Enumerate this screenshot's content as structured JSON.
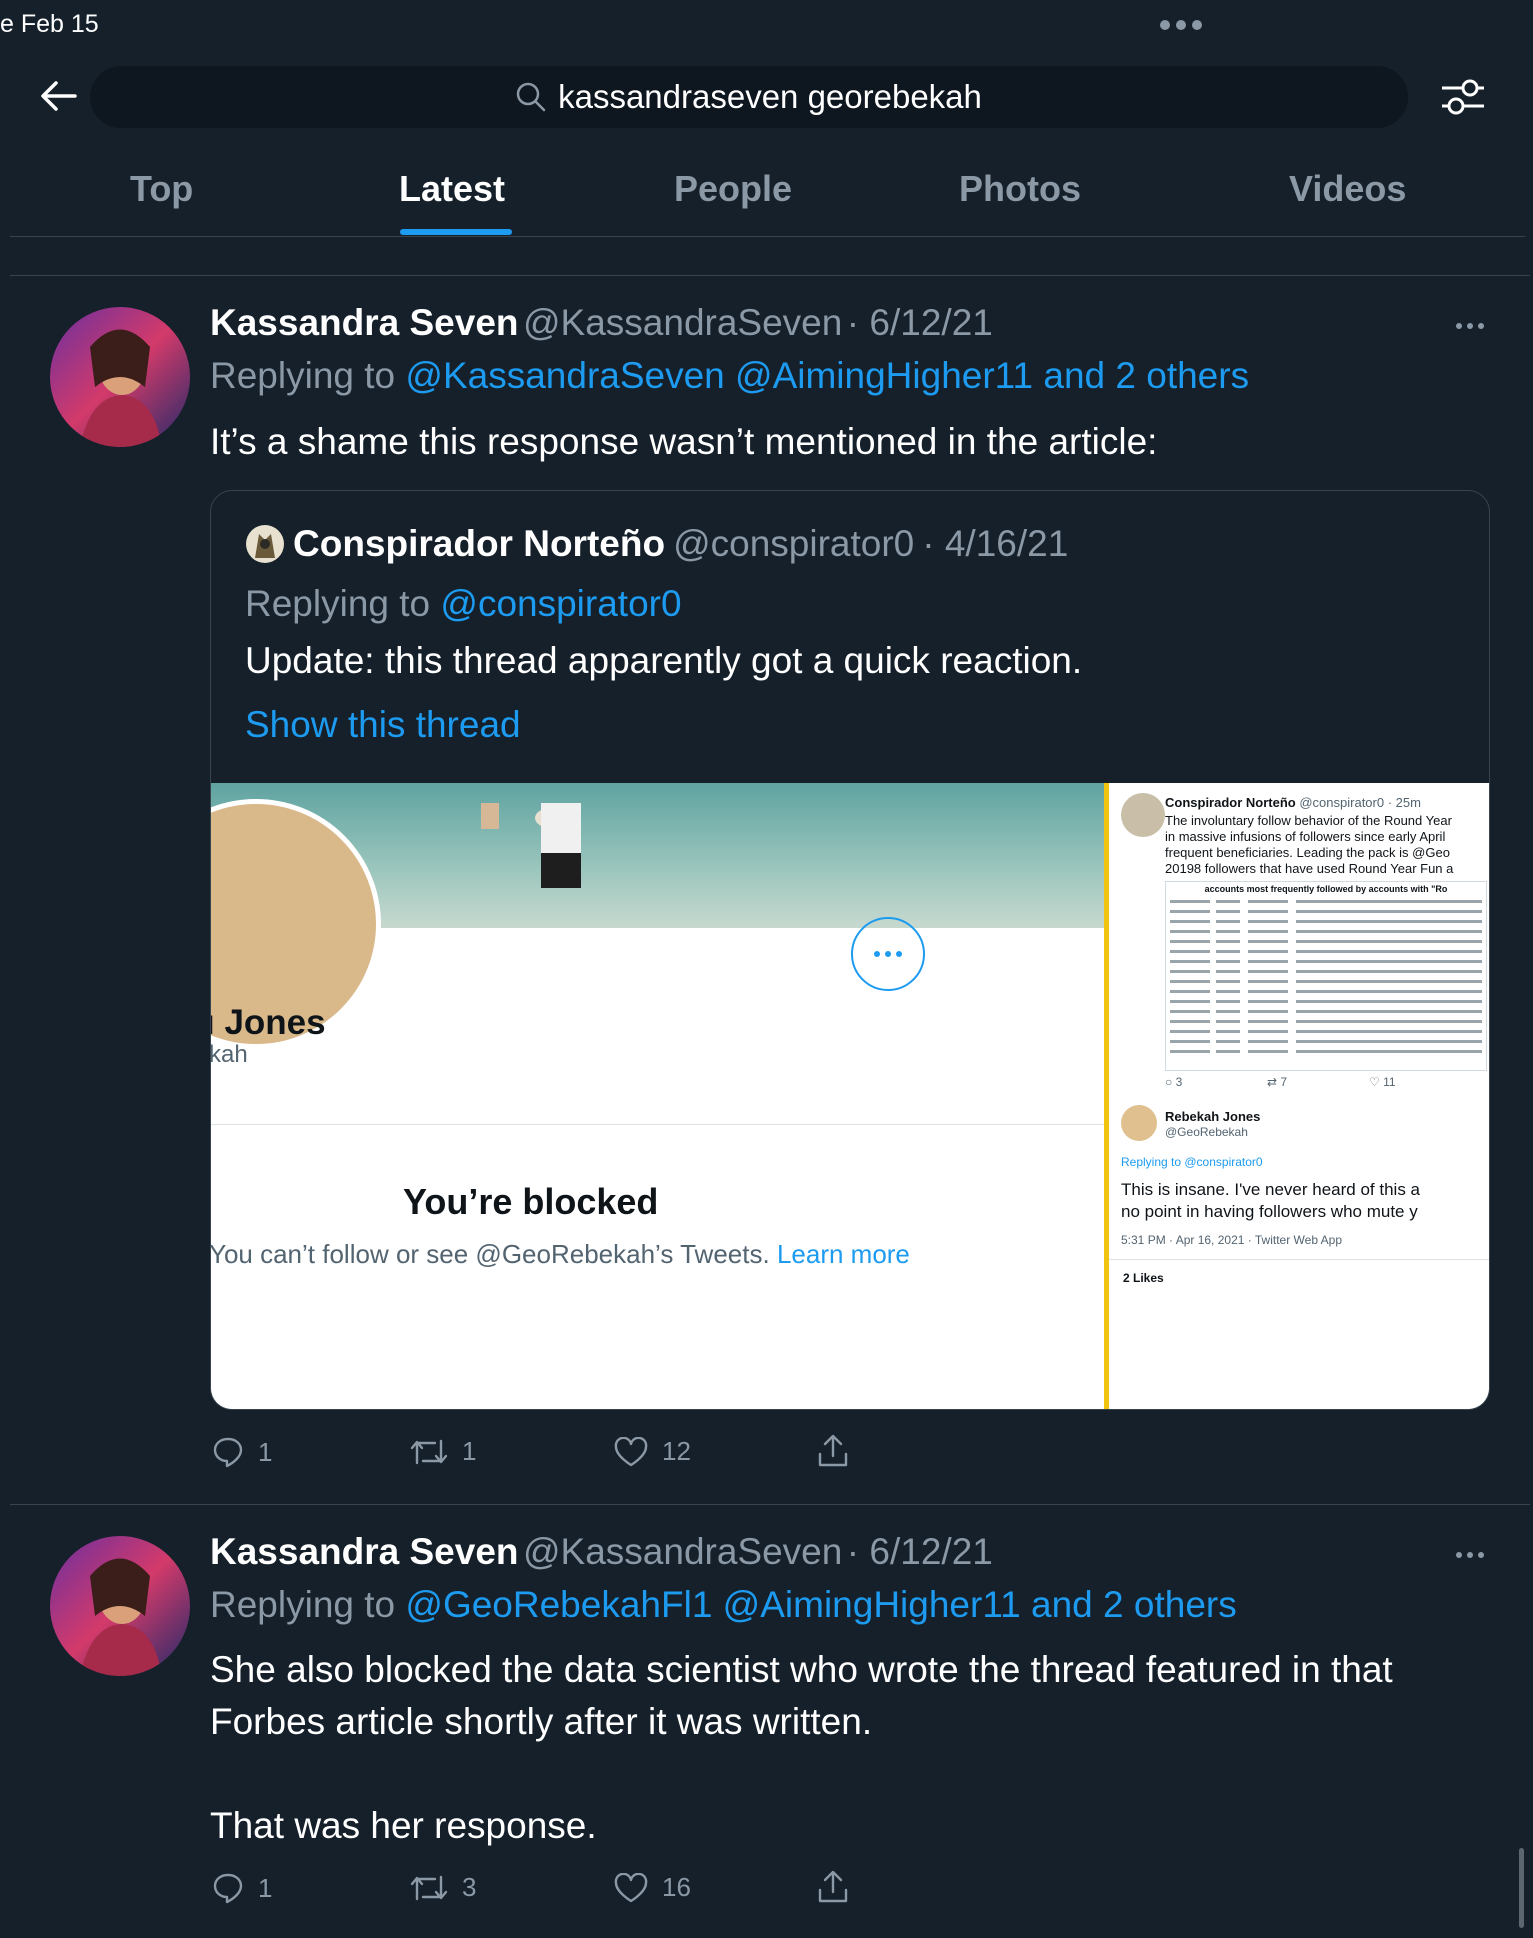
{
  "status": {
    "time": "e Feb 15"
  },
  "search": {
    "query": "kassandraseven georebekah"
  },
  "tabs": [
    "Top",
    "Latest",
    "People",
    "Photos",
    "Videos"
  ],
  "tweets": [
    {
      "name": "Kassandra Seven",
      "handle": "@KassandraSeven",
      "date": "· 6/12/21",
      "replying_prefix": "Replying to ",
      "replying_users": "@KassandraSeven @AimingHigher11 and 2 others",
      "text": "It’s a shame this response wasn’t mentioned in the article:",
      "quote": {
        "name": "Conspirador Norteño",
        "handle": "@conspirator0",
        "date": "· 4/16/21",
        "replying_prefix": "Replying to ",
        "replying_users": "@conspirator0",
        "text": "Update: this thread apparently got a quick reaction.",
        "show_thread": "Show this thread",
        "media": {
          "left": {
            "name_partial": "ı Jones",
            "handle_partial": "kah",
            "blocked_title": "You’re blocked",
            "blocked_text": "You can’t follow or see @GeoRebekah’s Tweets.",
            "learn_more": "Learn more"
          },
          "right": {
            "author": "Conspirador Norteño",
            "author_handle": "@conspirator0 · 25m",
            "body_1": "The involuntary follow behavior of the Round Year",
            "body_2": "in massive infusions of followers since early April",
            "body_3": "frequent beneficiaries. Leading the pack is @Geo",
            "body_4": "20198 followers that have used Round Year Fun a",
            "table_title": "accounts most frequently followed by accounts with \"Ro",
            "stats": [
              "3",
              "7",
              "11"
            ],
            "reply_author": "Rebekah Jones",
            "reply_handle": "@GeoRebekah",
            "reply_to": "Replying to @conspirator0",
            "reply_text_1": "This is insane. I've never heard of this a",
            "reply_text_2": "no point in having followers who mute y",
            "reply_meta": "5:31 PM · Apr 16, 2021 · Twitter Web App",
            "likes": "2 Likes"
          }
        }
      },
      "stats": {
        "replies": "1",
        "retweets": "1",
        "likes": "12"
      }
    },
    {
      "name": "Kassandra Seven",
      "handle": "@KassandraSeven",
      "date": "· 6/12/21",
      "replying_prefix": "Replying to ",
      "replying_users": "@GeoRebekahFl1 @AimingHigher11 and 2 others",
      "text_1": "She also blocked the data scientist who wrote the thread featured in that",
      "text_2": "Forbes article shortly after it was written.",
      "text_3": "That was her response.",
      "stats": {
        "replies": "1",
        "retweets": "3",
        "likes": "16"
      }
    }
  ],
  "colors": {
    "background": "#15202b",
    "accent": "#1d9bf0",
    "secondary_text": "#8b98a5",
    "media_border": "#f1c40f"
  }
}
